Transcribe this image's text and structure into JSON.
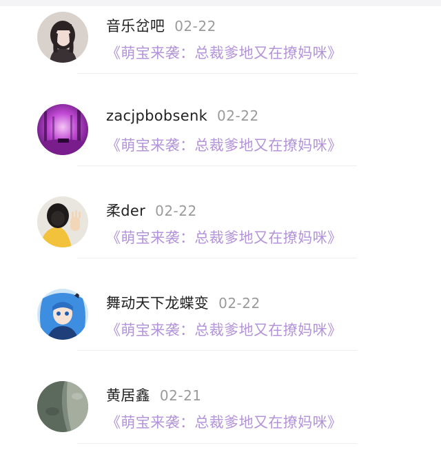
{
  "comments": [
    {
      "user": "音乐岔吧",
      "date": "02-22",
      "link_text": "《萌宝来袭：总裁爹地又在撩妈咪》",
      "avatar_icon": "avatar-girl-portrait"
    },
    {
      "user": "zacjpbobsenk",
      "date": "02-22",
      "link_text": "《萌宝来袭：总裁爹地又在撩妈咪》",
      "avatar_icon": "avatar-purple-forest"
    },
    {
      "user": "柔der",
      "date": "02-22",
      "link_text": "《萌宝来袭：总裁爹地又在撩妈咪》",
      "avatar_icon": "avatar-hooded-figure"
    },
    {
      "user": "舞动天下龙蝶变",
      "date": "02-22",
      "link_text": "《萌宝来袭：总裁爹地又在撩妈咪》",
      "avatar_icon": "avatar-anime-character"
    },
    {
      "user": "黄居鑫",
      "date": "02-21",
      "link_text": "《萌宝来袭：总裁爹地又在撩妈咪》",
      "avatar_icon": "avatar-stone-texture"
    }
  ],
  "colors": {
    "link": "#b393d9",
    "name": "#222222",
    "date": "#9a9a9a",
    "divider": "#eeeeee"
  }
}
